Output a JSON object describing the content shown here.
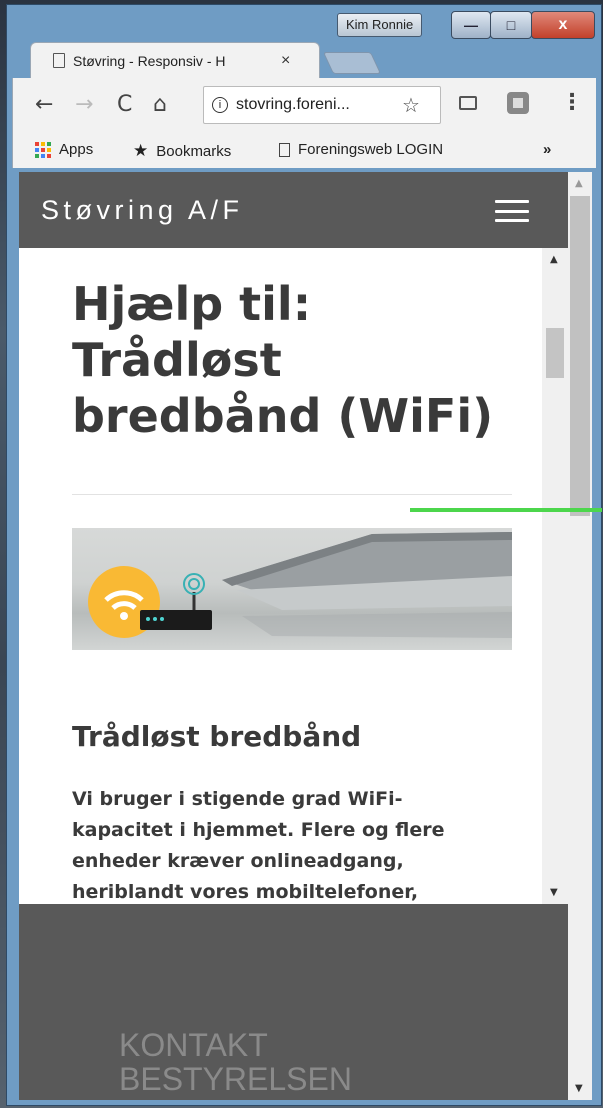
{
  "window": {
    "user_badge": "Kim Ronnie",
    "controls": {
      "minimize": "—",
      "maximize": "□",
      "close": "x"
    }
  },
  "tab": {
    "title": "Støvring - Responsiv - H",
    "close": "×"
  },
  "toolbar": {
    "back": "←",
    "forward": "→",
    "reload": "C",
    "home": "⌂",
    "info": "i",
    "url": "stovring.foreni...",
    "star": "☆",
    "menu": "⋮"
  },
  "bookmarks": {
    "apps": "Apps",
    "apps_colors": [
      "#ea4335",
      "#fbbc05",
      "#34a853",
      "#4285f4",
      "#ea4335",
      "#fbbc05",
      "#34a853",
      "#4285f4",
      "#ea4335"
    ],
    "bookmarks": "Bookmarks",
    "bookmarks_star": "★",
    "login": "Foreningsweb LOGIN",
    "more": "»"
  },
  "site": {
    "brand": "Støvring A/F",
    "heading": "Hjælp til: Trådløst bredbånd (WiFi)",
    "subheading": "Trådløst bredbånd",
    "paragraph": "Vi bruger i stigende grad WiFi-kapacitet i hjemmet. Flere og flere enheder kræver onlineadgang, heriblandt vores mobiltelefoner,",
    "footer_title": "KONTAKT BESTYRELSEN",
    "header_bg": "#595959",
    "text_color": "#3a3a3a",
    "wifi_accent": "#f9b934"
  },
  "scrollbar": {
    "up": "▲",
    "down": "▼"
  }
}
